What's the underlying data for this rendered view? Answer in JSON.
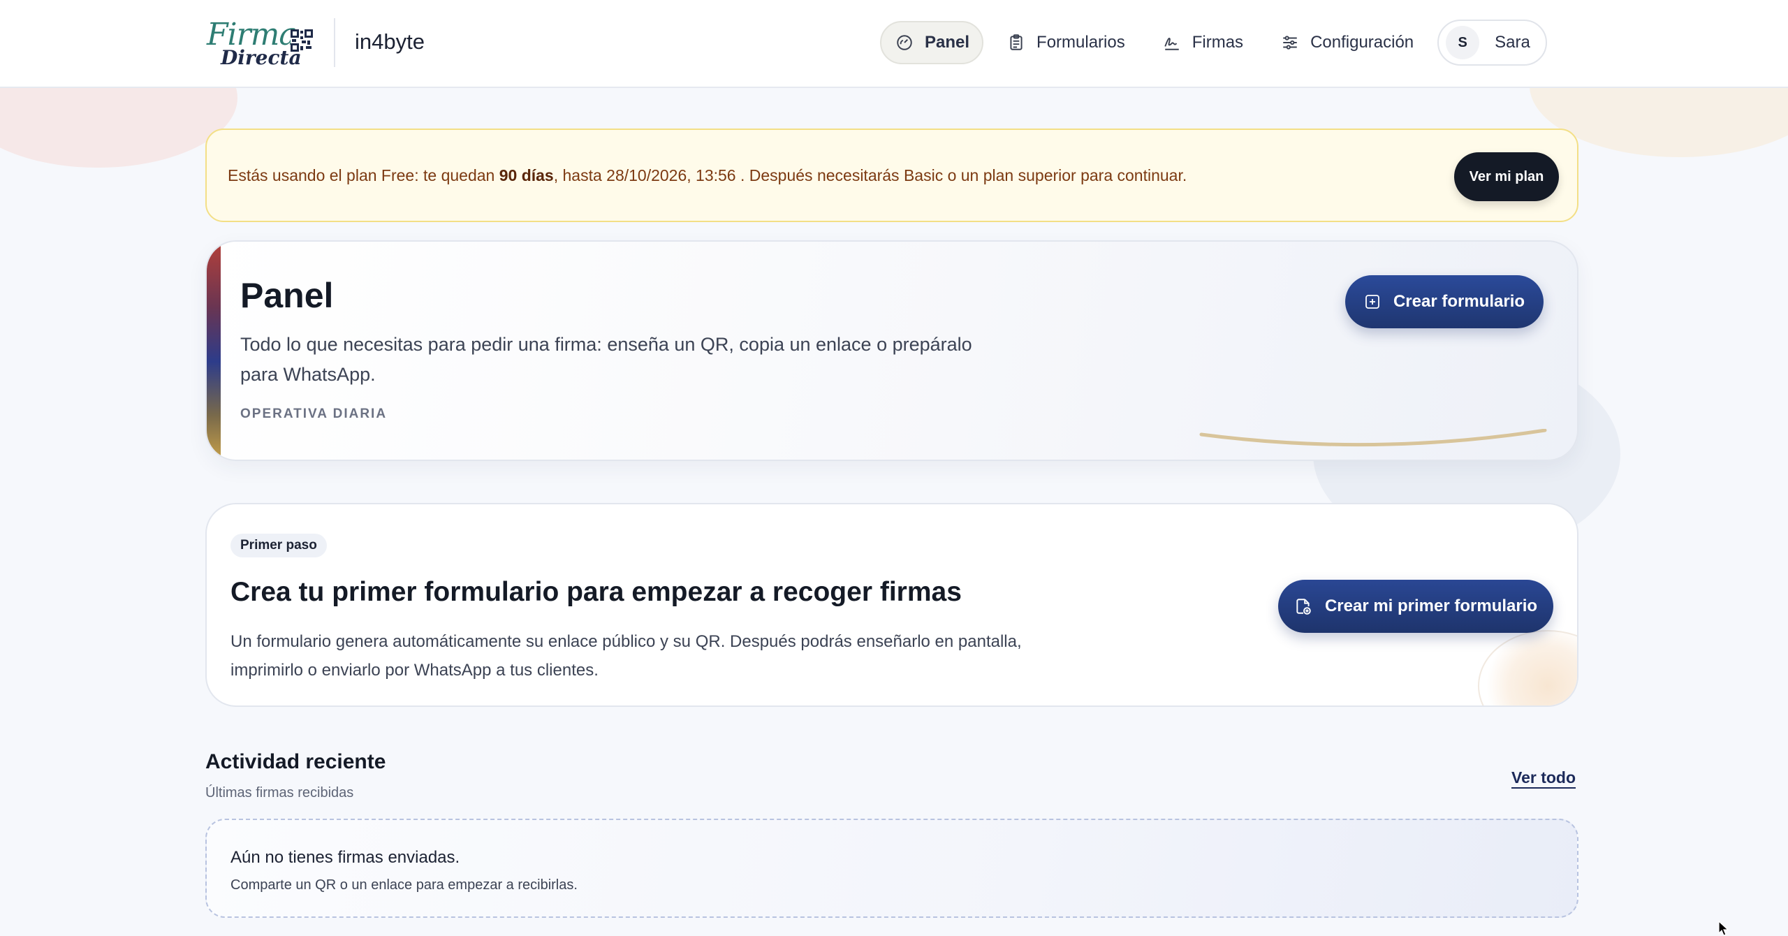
{
  "brand": {
    "logo_line1": "Firma",
    "logo_line2": "Directa",
    "company": "in4byte"
  },
  "nav": {
    "items": [
      {
        "label": "Panel",
        "icon": "dashboard-icon",
        "active": true
      },
      {
        "label": "Formularios",
        "icon": "clipboard-icon",
        "active": false
      },
      {
        "label": "Firmas",
        "icon": "signature-icon",
        "active": false
      },
      {
        "label": "Configuración",
        "icon": "sliders-icon",
        "active": false
      }
    ],
    "user": {
      "initial": "S",
      "name": "Sara"
    }
  },
  "banner": {
    "text_before": "Estás usando el plan Free: te quedan ",
    "days": "90 días",
    "text_after": ", hasta 28/10/2026, 13:56 . Después necesitarás Basic o un plan superior para continuar.",
    "button": "Ver mi plan"
  },
  "hero": {
    "title": "Panel",
    "description": "Todo lo que necesitas para pedir una firma: enseña un QR, copia un enlace o prepáralo para WhatsApp.",
    "eyebrow": "OPERATIVA DIARIA",
    "button": "Crear formulario"
  },
  "first_step": {
    "badge": "Primer paso",
    "title": "Crea tu primer formulario para empezar a recoger firmas",
    "description": "Un formulario genera automáticamente su enlace público y su QR. Después podrás enseñarlo en pantalla, imprimirlo o enviarlo por WhatsApp a tus clientes.",
    "button": "Crear mi primer formulario"
  },
  "recent": {
    "title": "Actividad reciente",
    "subtitle": "Últimas firmas recibidas",
    "see_all": "Ver todo",
    "empty_title": "Aún no tienes firmas enviadas.",
    "empty_subtitle": "Comparte un QR o un enlace para empezar a recibirlas."
  },
  "colors": {
    "primary": "#1f3670",
    "banner_bg": "#fffbea",
    "banner_text": "#7c3a12",
    "dark_button": "#141a26",
    "brand_green": "#2e7d73"
  }
}
